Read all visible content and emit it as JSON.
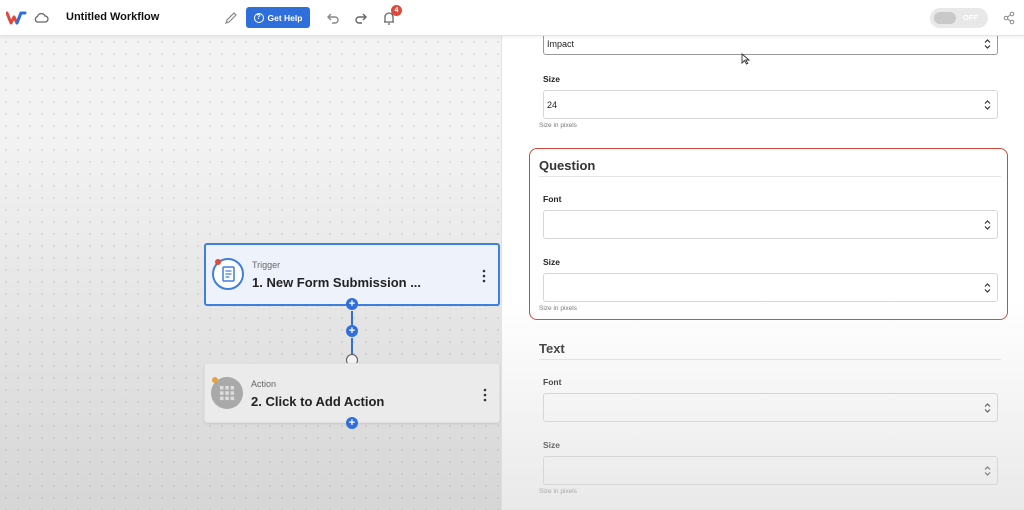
{
  "topbar": {
    "workflow_title": "Untitled Workflow",
    "help_button": "Get Help",
    "notification_count": "4",
    "toggle_label": "OFF"
  },
  "colors": {
    "accent": "#2f6fdc",
    "highlight_border": "#d2473a",
    "badge": "#e0483a"
  },
  "canvas": {
    "trigger": {
      "kind": "Trigger",
      "name": "1. New Form Submission ..."
    },
    "action": {
      "kind": "Action",
      "name": "2. Click to Add Action"
    },
    "add_symbol": "+"
  },
  "panel": {
    "top_font_value": "Impact",
    "title_size": {
      "label": "Size",
      "value": "24",
      "hint": "Size in pixels"
    },
    "question": {
      "title": "Question",
      "font_label": "Font",
      "font_value": "",
      "size_label": "Size",
      "size_value": "",
      "hint": "Size in pixels"
    },
    "text": {
      "title": "Text",
      "font_label": "Font",
      "font_value": "",
      "size_label": "Size",
      "size_value": "",
      "hint": "Size in pixels"
    }
  },
  "icons": [
    "logo-icon",
    "cloud-icon",
    "pencil-icon",
    "help-icon",
    "undo-icon",
    "redo-icon",
    "bell-icon",
    "share-icon",
    "form-icon",
    "grid-icon",
    "kebab-menu-icon",
    "select-arrows-icon",
    "cursor-icon"
  ]
}
